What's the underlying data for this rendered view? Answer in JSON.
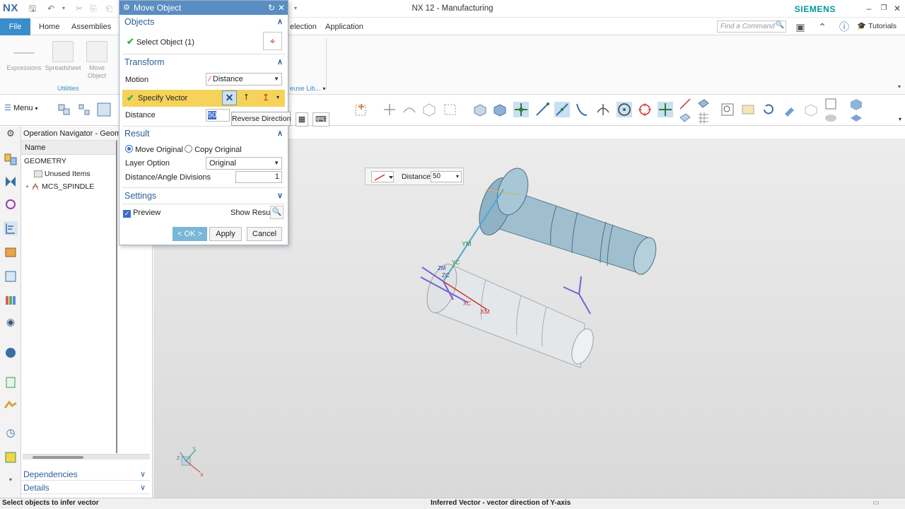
{
  "app": {
    "logo": "NX",
    "window_title": "NX 12 - Manufacturing",
    "brand": "SIEMENS",
    "brand_color": "#00999a"
  },
  "tabs": {
    "file": "File",
    "home": "Home",
    "assemblies": "Assemblies",
    "selection": "election",
    "application": "Application",
    "find_placeholder": "Find a Command",
    "tutorials": "Tutorials"
  },
  "ribbon": {
    "expressions": "Expressions",
    "spreadsheet": "Spreadsheet",
    "move_object": "Move Object",
    "utilities": "Utilities",
    "reuse_lib": "euse Lib...",
    "menu": "Menu"
  },
  "navigator": {
    "title": "Operation Navigator - Geome",
    "column_name": "Name",
    "rows": [
      "GEOMETRY",
      "Unused Items",
      "MCS_SPINDLE"
    ],
    "dependencies": "Dependencies",
    "details": "Details"
  },
  "dialog": {
    "title": "Move Object",
    "objects_section": "Objects",
    "select_object": "Select Object (1)",
    "transform_section": "Transform",
    "motion_label": "Motion",
    "motion_value": "Distance",
    "specify_vector": "Specify Vector",
    "distance_label": "Distance",
    "distance_value": "50",
    "result_section": "Result",
    "move_original": "Move Original",
    "copy_original": "Copy Original",
    "result_choice": "move_original",
    "layer_option_label": "Layer Option",
    "layer_option_value": "Original",
    "divisions_label": "Distance/Angle Divisions",
    "divisions_value": "1",
    "settings_section": "Settings",
    "preview_label": "Preview",
    "preview_checked": true,
    "show_result": "Show Result",
    "ok": "< OK >",
    "apply": "Apply",
    "cancel": "Cancel"
  },
  "tooltip": "Reverse Direction",
  "dynamic_input": {
    "label": "Distance",
    "value": "50"
  },
  "axes": {
    "ym": "YM",
    "yc": "YC",
    "zm": "ZM",
    "zc": "ZC",
    "xc": "XC",
    "xm": "XM",
    "triad_x": "X",
    "triad_y": "Y",
    "triad_z": "Z"
  },
  "status": {
    "left": "Select objects to infer vector",
    "center": "Inferred Vector - vector direction of Y-axis"
  },
  "colors": {
    "accent": "#3a8dc9",
    "dialog_title": "#5a8dc1",
    "highlight_yellow": "#f5d35a",
    "section_blue": "#2d5f97"
  }
}
